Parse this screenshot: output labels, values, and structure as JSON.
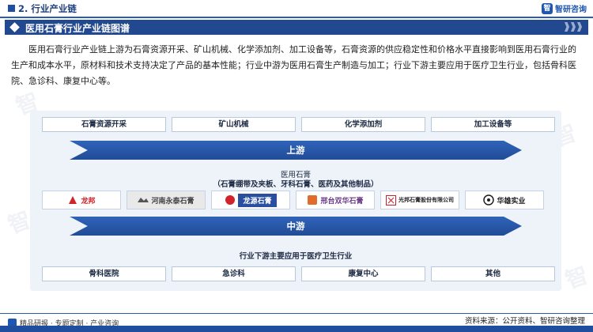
{
  "header": {
    "section_title": "2. 行业产业链",
    "brand_logo": "智",
    "brand_name": "智研咨询"
  },
  "title_band": {
    "title": "医用石膏行业产业链图谱"
  },
  "intro": "医用石膏行业产业链上游为石膏资源开采、矿山机械、化学添加剂、加工设备等，石膏资源的供应稳定性和价格水平直接影响到医用石膏行业的生产和成本水平，原材料和技术支持决定了产品的基本性能；行业中游为医用石膏生产制造与加工；行业下游主要应用于医疗卫生行业，包括骨科医院、急诊科、康复中心等。",
  "diagram": {
    "upstream_items": [
      "石膏资源开采",
      "矿山机械",
      "化学添加剂",
      "加工设备等"
    ],
    "upstream_label": "上游",
    "midstream_title": "医用石膏",
    "midstream_subtitle": "（石膏绷带及夹板、牙科石膏、医药及其他制品）",
    "companies": [
      {
        "name": "龙邦",
        "icon": "longbang-logo",
        "color": "#d2232a"
      },
      {
        "name": "河南永泰石膏",
        "icon": "yongtai-logo",
        "color": "#444444"
      },
      {
        "name": "龙源石膏",
        "icon": "longyuan-logo",
        "color": "#2a4fa0"
      },
      {
        "name": "邢台双华石膏",
        "icon": "shuanghua-logo",
        "color": "#6b3a8a"
      },
      {
        "name": "光邦石膏股份有限公司",
        "icon": "guangbang-logo",
        "color": "#c8202a"
      },
      {
        "name": "华雄实业",
        "icon": "huaxiong-logo",
        "color": "#1c1c1c"
      }
    ],
    "midstream_label": "中游",
    "downstream_title": "行业下游主要应用于医疗卫生行业",
    "downstream_items": [
      "骨科医院",
      "急诊科",
      "康复中心",
      "其他"
    ]
  },
  "footer": {
    "left_text": "精品研报 · 专题定制 · 产业咨询",
    "source": "资料来源：公开资料、智研咨询整理"
  }
}
